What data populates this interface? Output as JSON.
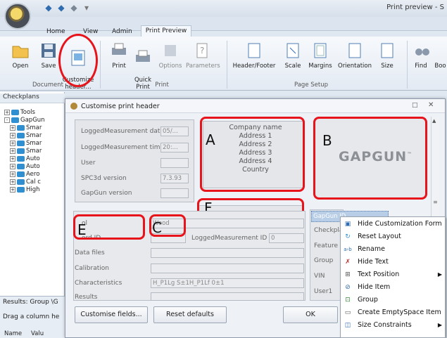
{
  "window": {
    "title": "Print preview - S"
  },
  "tabs": [
    "Home",
    "View",
    "Admin",
    "Print Preview"
  ],
  "ribbon": {
    "document": {
      "group": "Document",
      "buttons": [
        "Open",
        "Save",
        "Customize\nheader..."
      ]
    },
    "print": {
      "group": "Print",
      "buttons": [
        "Print",
        "Quick\nPrint",
        "Options",
        "Parameters"
      ]
    },
    "page_setup": {
      "group": "Page Setup",
      "buttons": [
        "Header/Footer",
        "Scale",
        "Margins",
        "Orientation",
        "Size"
      ]
    },
    "other": {
      "buttons": [
        "Find",
        "Boo"
      ]
    }
  },
  "left_panel": {
    "header": "Checkplans",
    "tree": [
      "Tools",
      "GapGun",
      "Smar",
      "Smar",
      "Smar",
      "Smar",
      "Auto",
      "Auto",
      "Aero",
      "Cal c",
      "High"
    ],
    "results_label": "Results: Group \\G",
    "drag_text": "Drag a column he",
    "columns": [
      "Name",
      "Valu"
    ]
  },
  "dialog": {
    "title": "Customise print header",
    "fields": [
      {
        "label": "LoggedMeasurement date",
        "value": "05/..."
      },
      {
        "label": "LoggedMeasurement time",
        "value": "20:..."
      },
      {
        "label": "User",
        "value": ""
      },
      {
        "label": "SPC3d version",
        "value": "7.3.93"
      },
      {
        "label": "GapGun version",
        "value": ""
      }
    ],
    "company": [
      "Company name",
      "Address 1",
      "Address 2",
      "Address 3",
      "Address 4",
      "Country"
    ],
    "logo_text": "GAPGUN",
    "logo_tm": "™",
    "lower_fields": [
      {
        "label": "ol",
        "value": "Wood"
      },
      {
        "label": "ord ID",
        "value": ""
      },
      {
        "label": "Data files",
        "value": ""
      },
      {
        "label": "Calibration",
        "value": ""
      },
      {
        "label": "Characteristics",
        "value": "H_P1Lg S±1H_P1Lf 0±1"
      },
      {
        "label": "Results",
        "value": ""
      }
    ],
    "logged_id_label": "LoggedMeasurement ID",
    "logged_id_value": "0",
    "right_labels": [
      "GapGun ID",
      "Checkplan",
      "Feature",
      "Group",
      "VIN",
      "User1"
    ],
    "buttons": {
      "customise": "Customise fields...",
      "reset": "Reset defaults",
      "ok": "OK"
    },
    "annotations": [
      "A",
      "B",
      "C",
      "E",
      "F"
    ]
  },
  "context_menu": [
    {
      "icon": "hide-customization-icon",
      "label": "Hide Customization Form",
      "submenu": false
    },
    {
      "icon": "reset-layout-icon",
      "label": "Reset Layout",
      "submenu": false
    },
    {
      "icon": "rename-icon",
      "label": "Rename",
      "submenu": false
    },
    {
      "icon": "hide-text-icon",
      "label": "Hide Text",
      "submenu": false
    },
    {
      "icon": "text-position-icon",
      "label": "Text Position",
      "submenu": true
    },
    {
      "icon": "hide-item-icon",
      "label": "Hide Item",
      "submenu": false
    },
    {
      "icon": "group-icon",
      "label": "Group",
      "submenu": false
    },
    {
      "icon": "empty-space-icon",
      "label": "Create EmptySpace Item",
      "submenu": false
    },
    {
      "icon": "size-constraints-icon",
      "label": "Size Constraints",
      "submenu": true
    }
  ],
  "colors": {
    "highlight": "#e8141b",
    "ribbon_bg": "#e3eaf3",
    "accent": "#2f6db0"
  }
}
